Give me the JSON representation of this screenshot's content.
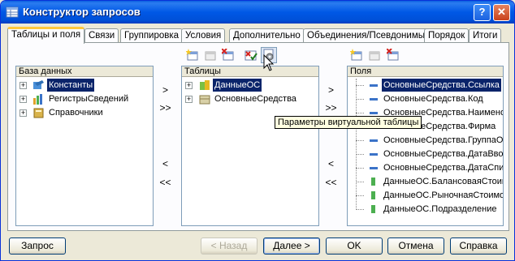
{
  "window": {
    "title": "Конструктор запросов",
    "help_glyph": "?",
    "close_glyph": "✕"
  },
  "tabs": [
    {
      "label": "Таблицы и поля",
      "active": true
    },
    {
      "label": "Связи"
    },
    {
      "label": "Группировка"
    },
    {
      "label": "Условия"
    },
    {
      "label": "Дополнительно"
    },
    {
      "label": "Объединения/Псевдонимы"
    },
    {
      "label": "Порядок"
    },
    {
      "label": "Итоги"
    }
  ],
  "database": {
    "header": "База данных",
    "items": [
      {
        "label": "Константы",
        "icon": "constants-icon",
        "selected": true
      },
      {
        "label": "РегистрыСведений",
        "icon": "registers-icon"
      },
      {
        "label": "Справочники",
        "icon": "catalogs-icon"
      }
    ]
  },
  "tables": {
    "header": "Таблицы",
    "items": [
      {
        "label": "ДанныеОС",
        "icon": "virtual-table-icon",
        "selected": true
      },
      {
        "label": "ОсновныеСредства",
        "icon": "table-icon"
      }
    ]
  },
  "fields": {
    "header": "Поля",
    "items": [
      {
        "label": "ОсновныеСредства.Ссылка",
        "selected": true
      },
      {
        "label": "ОсновныеСредства.Код"
      },
      {
        "label": "ОсновныеСредства.Наименование"
      },
      {
        "label": "ОсновныеСредства.Фирма"
      },
      {
        "label": "ОсновныеСредства.ГруппаОС"
      },
      {
        "label": "ОсновныеСредства.ДатаВвода"
      },
      {
        "label": "ОсновныеСредства.ДатаСписания"
      },
      {
        "label": "ДанныеОС.БалансоваяСтоимость"
      },
      {
        "label": "ДанныеОС.РыночнаяСтоимость"
      },
      {
        "label": "ДанныеОС.Подразделение"
      }
    ]
  },
  "transfer": {
    "move_one": ">",
    "move_all": ">>",
    "back_one": "<",
    "back_all": "<<"
  },
  "tooltip": "Параметры виртуальной таблицы",
  "footer": {
    "query": "Запрос",
    "back": "< Назад",
    "next": "Далее >",
    "ok": "OK",
    "cancel": "Отмена",
    "help": "Справка"
  }
}
